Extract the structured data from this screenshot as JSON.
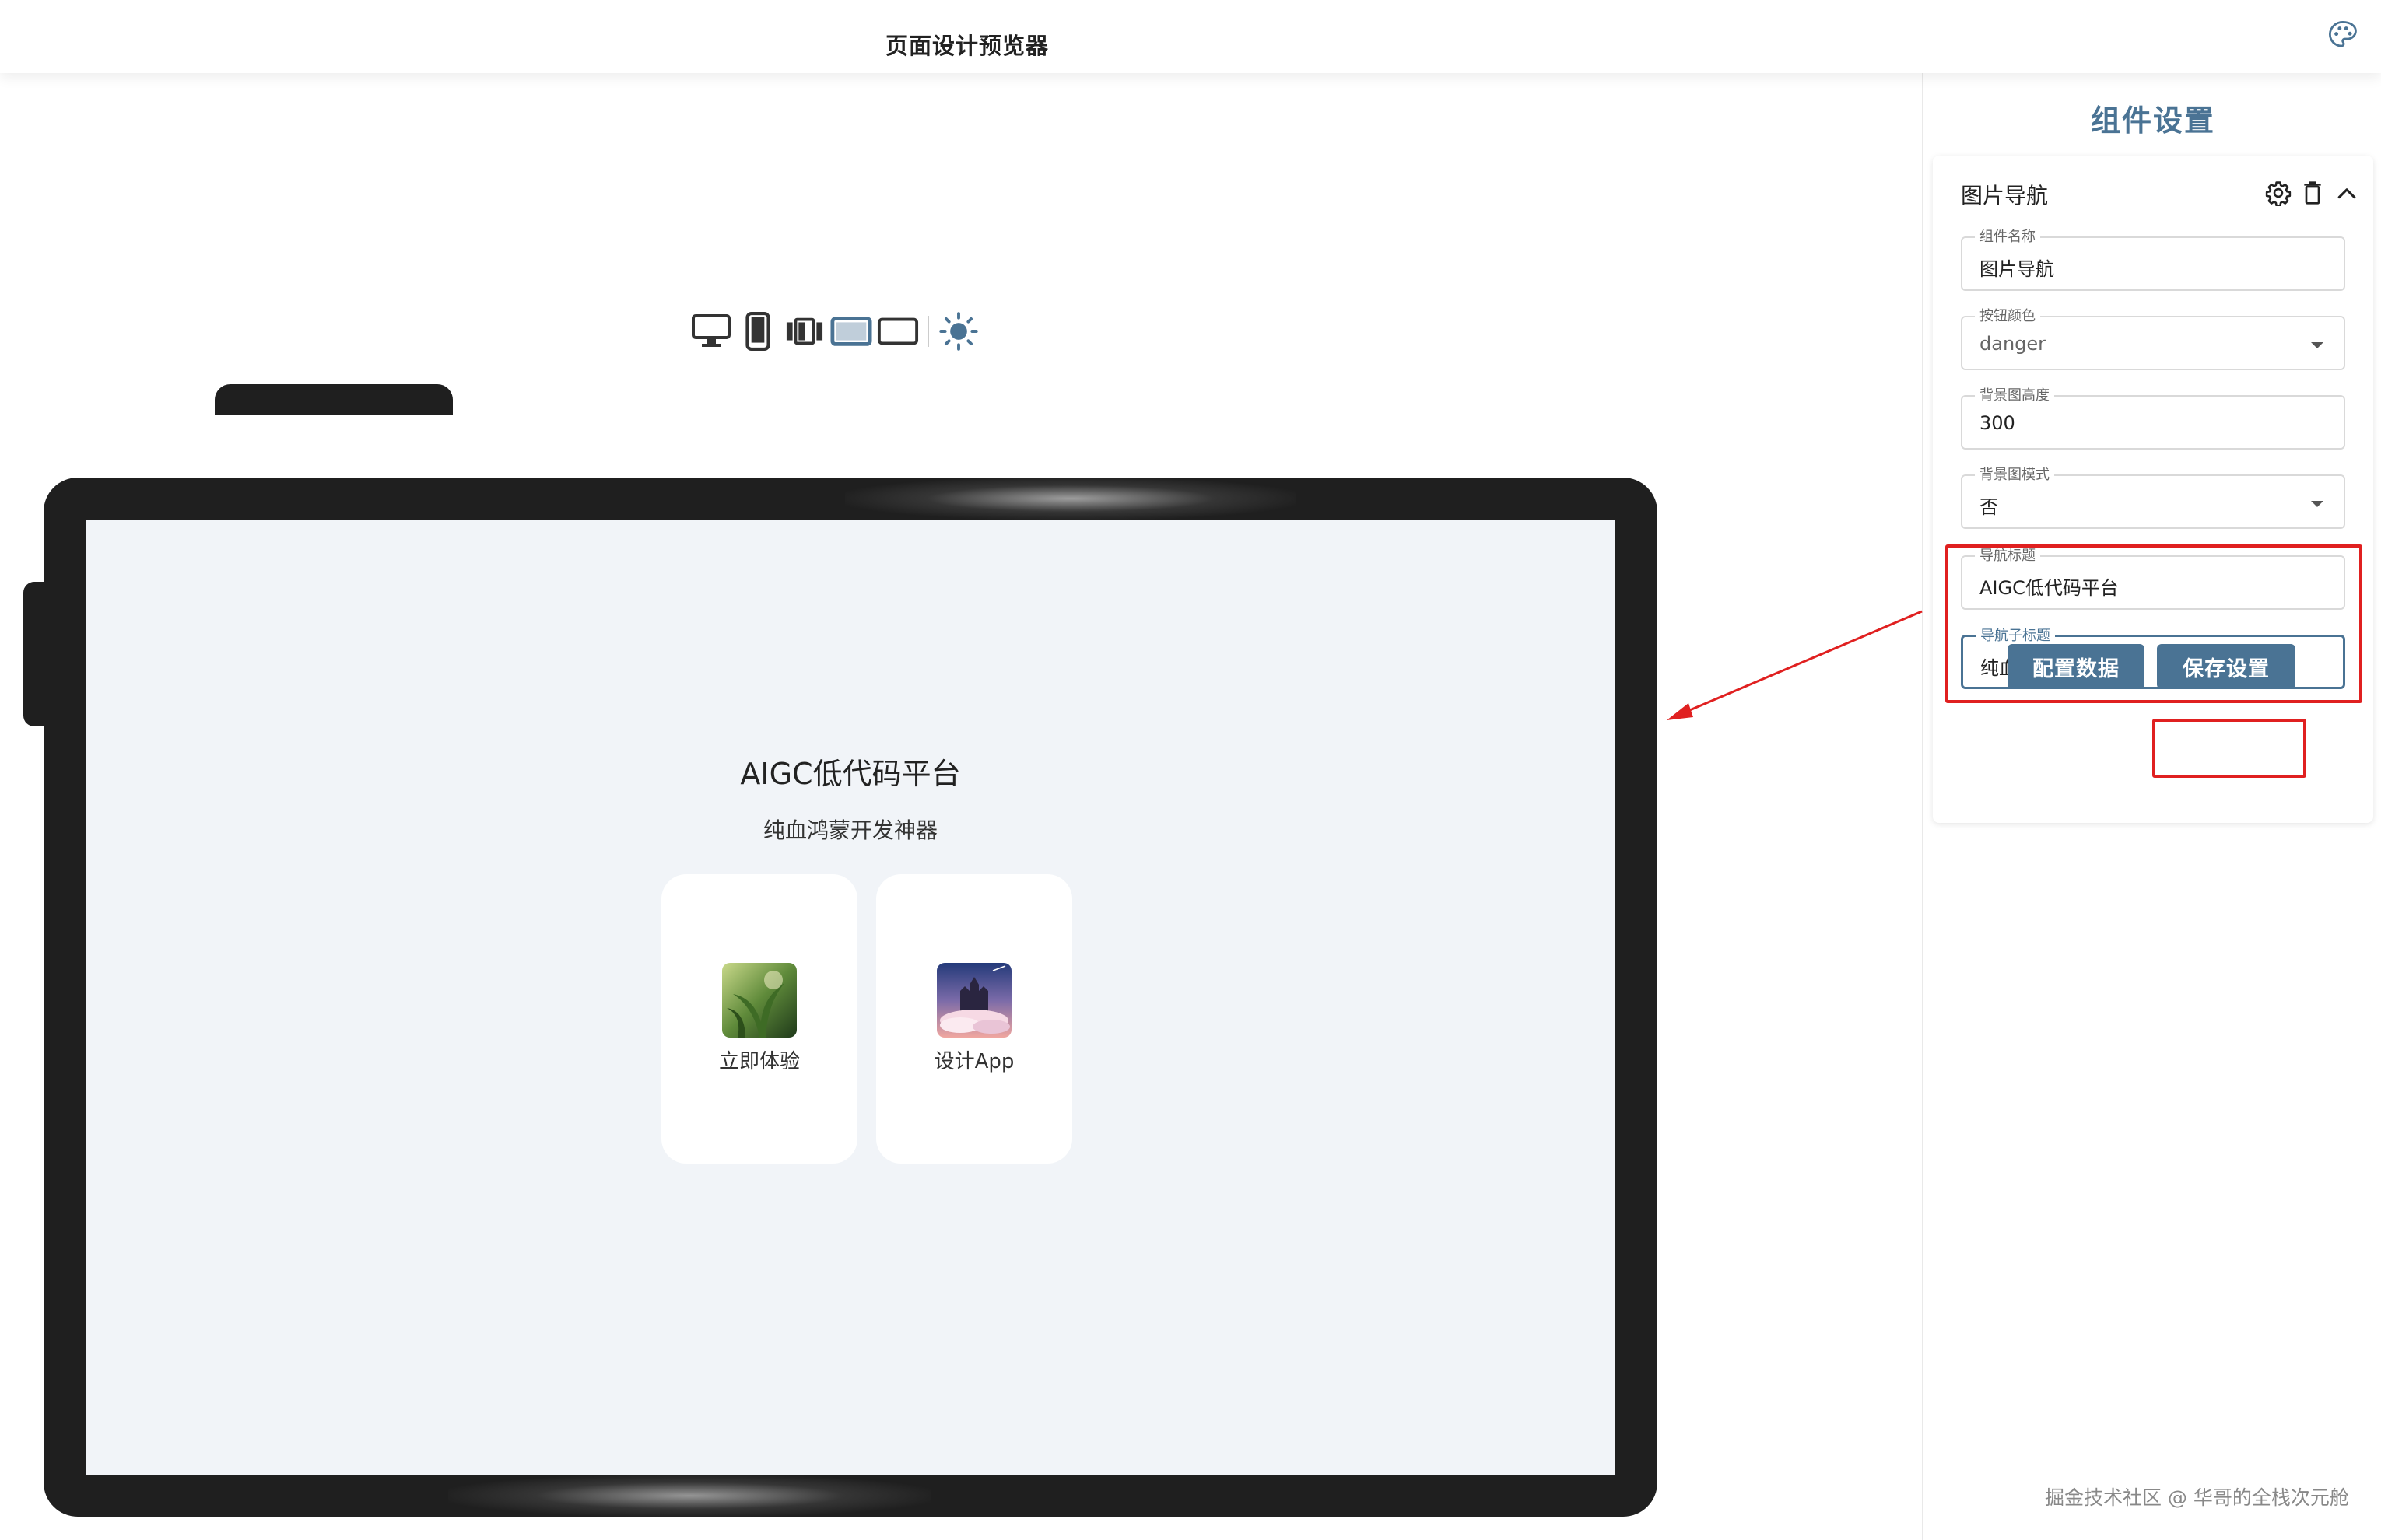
{
  "header": {
    "title": "页面设计预览器"
  },
  "toolbar": {
    "icons": [
      "desktop-icon",
      "phone-icon",
      "foldable-icon",
      "tablet-landscape-icon",
      "widescreen-icon",
      "brightness-icon"
    ],
    "active": "tablet-landscape-icon"
  },
  "preview": {
    "nav_title": "AIGC低代码平台",
    "nav_subtitle": "纯血鸿蒙开发神器",
    "cards": [
      {
        "label": "立即体验"
      },
      {
        "label": "设计App"
      }
    ]
  },
  "panel": {
    "title": "组件设置",
    "component": {
      "name": "图片导航",
      "fields": [
        {
          "label": "组件名称",
          "value": "图片导航"
        },
        {
          "label": "按钮颜色",
          "value": "danger"
        },
        {
          "label": "背景图高度",
          "value": "300"
        },
        {
          "label": "背景图模式",
          "value": "否"
        },
        {
          "label": "导航标题",
          "value": "AIGC低代码平台"
        },
        {
          "label": "导航子标题",
          "value": "纯血鸿蒙开发神器"
        }
      ],
      "buttons": {
        "config": "配置数据",
        "save": "保存设置"
      }
    }
  },
  "watermark": "掘金技术社区 @ 华哥的全栈次元舱",
  "colors": {
    "accent": "#4a7394",
    "annotation": "#e02020",
    "device": "#1f1f1f",
    "screen": "#f1f4f8"
  }
}
